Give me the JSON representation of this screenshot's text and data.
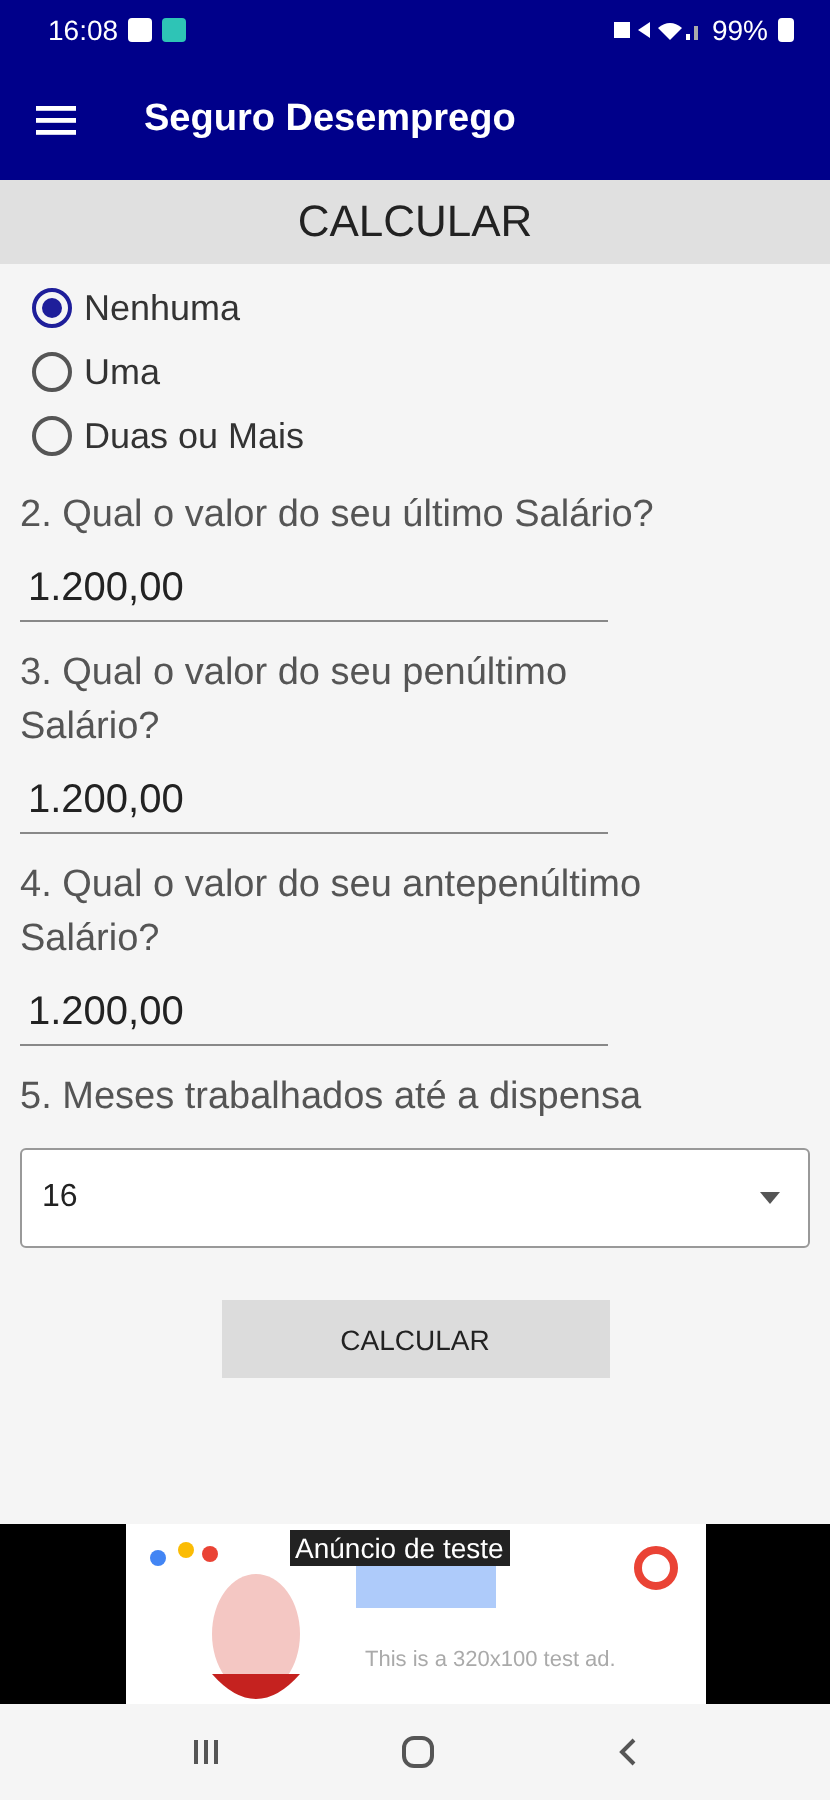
{
  "status_bar": {
    "time": "16:08",
    "battery": "99%"
  },
  "app_bar": {
    "title": "Seguro Desemprego"
  },
  "section_header": "CALCULAR",
  "radio_options": [
    {
      "label": "Nenhuma",
      "selected": true
    },
    {
      "label": "Uma",
      "selected": false
    },
    {
      "label": "Duas ou Mais",
      "selected": false
    }
  ],
  "questions": [
    {
      "label": "2. Qual o valor do seu último Salário?",
      "value": "1.200,00"
    },
    {
      "label": "3. Qual o valor do seu penúltimo Salário?",
      "value": "1.200,00"
    },
    {
      "label": "4. Qual o valor do seu antepenúltimo Salário?",
      "value": "1.200,00"
    }
  ],
  "months": {
    "label": "5. Meses trabalhados até a dispensa",
    "value": "16"
  },
  "calculate_button": "CALCULAR",
  "ad": {
    "badge": "Anúncio de teste",
    "text": "This is a 320x100 test ad."
  }
}
